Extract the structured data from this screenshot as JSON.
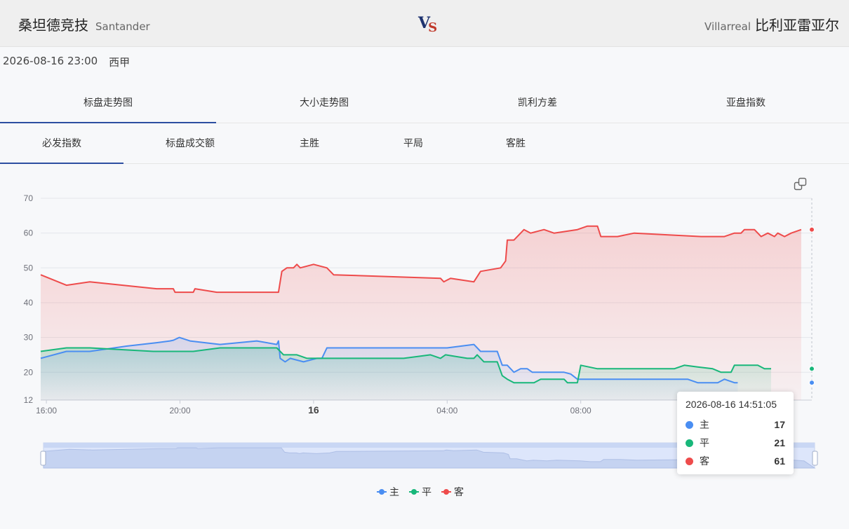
{
  "match": {
    "home_cn": "桑坦德竞技",
    "home_en": "Santander",
    "away_en": "Villarreal",
    "away_cn": "比利亚雷亚尔",
    "vs_v": "V",
    "vs_s": "S",
    "datetime": "2026-08-16 23:00",
    "league": "西甲"
  },
  "tabs_main": [
    "标盘走势图",
    "大小走势图",
    "凯利方差",
    "亚盘指数"
  ],
  "tabs_sub": [
    "必发指数",
    "标盘成交额",
    "主胜",
    "平局",
    "客胜"
  ],
  "colors": {
    "home": "#4a8ef2",
    "draw": "#18b77a",
    "away": "#ee4b4b",
    "accent": "#2d4fa1"
  },
  "chart_data": {
    "type": "line",
    "title": "",
    "ylim": [
      12,
      70
    ],
    "yticks": [
      12,
      20,
      30,
      40,
      50,
      60,
      70
    ],
    "xlim": [
      15.83,
      14.86
    ],
    "x_ticks": [
      {
        "x": 16.0,
        "label": "16:00",
        "bold": false
      },
      {
        "x": 20.0,
        "label": "20:00",
        "bold": false
      },
      {
        "x": 24.0,
        "label": "16",
        "bold": true
      },
      {
        "x": 28.0,
        "label": "04:00",
        "bold": false
      },
      {
        "x": 32.0,
        "label": "08:00",
        "bold": false
      }
    ],
    "series": [
      {
        "name": "主",
        "color": "#4a8ef2",
        "points": [
          [
            15.83,
            24
          ],
          [
            16.6,
            26
          ],
          [
            17.3,
            26
          ],
          [
            18.4,
            27.5
          ],
          [
            19.3,
            28.5
          ],
          [
            19.7,
            29
          ],
          [
            19.8,
            29.2
          ],
          [
            19.98,
            30
          ],
          [
            20.3,
            29
          ],
          [
            21.2,
            28
          ],
          [
            22.3,
            29
          ],
          [
            22.9,
            28
          ],
          [
            22.95,
            29
          ],
          [
            23.0,
            24
          ],
          [
            23.15,
            23
          ],
          [
            23.3,
            24
          ],
          [
            23.5,
            23.5
          ],
          [
            23.7,
            23
          ],
          [
            24.1,
            24
          ],
          [
            24.25,
            24
          ],
          [
            24.4,
            27
          ],
          [
            25.0,
            27
          ],
          [
            28.0,
            27
          ],
          [
            28.8,
            28
          ],
          [
            29.0,
            26
          ],
          [
            29.5,
            26
          ],
          [
            29.65,
            22
          ],
          [
            29.8,
            22
          ],
          [
            30.0,
            20
          ],
          [
            30.2,
            21
          ],
          [
            30.4,
            21
          ],
          [
            30.55,
            20
          ],
          [
            31.5,
            20
          ],
          [
            31.7,
            19.5
          ],
          [
            31.9,
            18
          ],
          [
            35.2,
            18
          ],
          [
            35.5,
            17
          ],
          [
            36.1,
            17
          ],
          [
            36.3,
            18
          ],
          [
            36.6,
            17
          ],
          [
            36.7,
            17
          ]
        ]
      },
      {
        "name": "平",
        "color": "#18b77a",
        "points": [
          [
            15.83,
            26
          ],
          [
            16.6,
            27
          ],
          [
            17.3,
            27
          ],
          [
            19.2,
            26
          ],
          [
            20.4,
            26
          ],
          [
            21.2,
            27
          ],
          [
            22.9,
            27
          ],
          [
            23.1,
            25
          ],
          [
            23.5,
            25
          ],
          [
            23.8,
            24
          ],
          [
            24.4,
            24
          ],
          [
            26.7,
            24
          ],
          [
            27.5,
            25
          ],
          [
            27.8,
            24
          ],
          [
            27.95,
            25
          ],
          [
            28.6,
            24
          ],
          [
            28.8,
            24
          ],
          [
            28.9,
            25
          ],
          [
            29.1,
            23
          ],
          [
            29.5,
            23
          ],
          [
            29.65,
            19
          ],
          [
            29.8,
            18
          ],
          [
            30.0,
            17
          ],
          [
            30.6,
            17
          ],
          [
            30.8,
            18
          ],
          [
            31.5,
            18
          ],
          [
            31.6,
            17
          ],
          [
            31.9,
            17
          ],
          [
            32.0,
            22
          ],
          [
            32.5,
            21
          ],
          [
            34.8,
            21
          ],
          [
            35.1,
            22
          ],
          [
            35.5,
            21.5
          ],
          [
            35.95,
            21
          ],
          [
            36.2,
            20
          ],
          [
            36.5,
            20
          ],
          [
            36.6,
            22
          ],
          [
            37.3,
            22
          ],
          [
            37.5,
            21
          ],
          [
            37.7,
            21
          ]
        ]
      },
      {
        "name": "客",
        "color": "#ee4b4b",
        "points": [
          [
            15.83,
            48
          ],
          [
            16.6,
            45
          ],
          [
            17.3,
            46
          ],
          [
            19.3,
            44
          ],
          [
            19.8,
            44
          ],
          [
            19.85,
            43
          ],
          [
            20.4,
            43
          ],
          [
            20.45,
            44
          ],
          [
            21.1,
            43
          ],
          [
            22.95,
            43
          ],
          [
            23.05,
            49
          ],
          [
            23.2,
            50
          ],
          [
            23.4,
            50
          ],
          [
            23.5,
            51
          ],
          [
            23.6,
            50
          ],
          [
            24.0,
            51
          ],
          [
            24.2,
            50.5
          ],
          [
            24.4,
            50
          ],
          [
            24.6,
            48
          ],
          [
            27.8,
            47
          ],
          [
            27.9,
            46
          ],
          [
            28.1,
            47
          ],
          [
            28.8,
            46
          ],
          [
            29.0,
            49
          ],
          [
            29.3,
            49.5
          ],
          [
            29.6,
            50
          ],
          [
            29.75,
            52
          ],
          [
            29.8,
            58
          ],
          [
            30.0,
            58
          ],
          [
            30.2,
            60
          ],
          [
            30.3,
            61
          ],
          [
            30.5,
            60
          ],
          [
            30.7,
            60.5
          ],
          [
            30.9,
            61
          ],
          [
            31.2,
            60
          ],
          [
            31.9,
            61
          ],
          [
            32.2,
            62
          ],
          [
            32.5,
            62
          ],
          [
            32.6,
            59
          ],
          [
            33.1,
            59
          ],
          [
            33.6,
            60
          ],
          [
            35.6,
            59
          ],
          [
            36.3,
            59
          ],
          [
            36.6,
            60
          ],
          [
            36.8,
            60
          ],
          [
            36.9,
            61
          ],
          [
            37.2,
            61
          ],
          [
            37.4,
            59
          ],
          [
            37.6,
            60
          ],
          [
            37.8,
            59
          ],
          [
            37.9,
            60
          ],
          [
            38.1,
            59
          ],
          [
            38.3,
            60
          ],
          [
            38.6,
            61
          ]
        ]
      }
    ],
    "legend": [
      "主",
      "平",
      "客"
    ],
    "legend_position": "bottom-center",
    "grid": true,
    "tooltip": {
      "time": "2026-08-16 14:51:05",
      "rows": [
        {
          "name": "主",
          "value": "17",
          "color": "#4a8ef2"
        },
        {
          "name": "平",
          "value": "21",
          "color": "#18b77a"
        },
        {
          "name": "客",
          "value": "61",
          "color": "#ee4b4b"
        }
      ]
    }
  }
}
